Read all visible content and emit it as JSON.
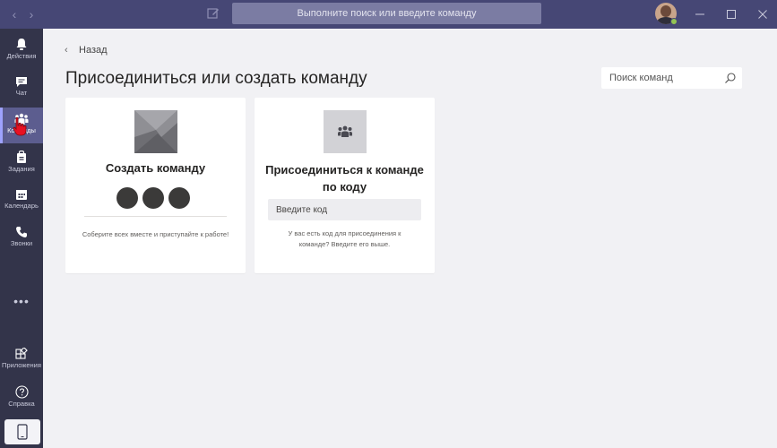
{
  "titlebar": {
    "search_placeholder": "Выполните поиск или введите команду"
  },
  "rail": {
    "items": [
      {
        "label": "Действия",
        "icon": "bell-icon"
      },
      {
        "label": "Чат",
        "icon": "chat-icon"
      },
      {
        "label": "Команды",
        "icon": "teams-icon",
        "active": true
      },
      {
        "label": "Задания",
        "icon": "assignments-icon"
      },
      {
        "label": "Календарь",
        "icon": "calendar-icon"
      },
      {
        "label": "Звонки",
        "icon": "phone-icon"
      },
      {
        "label": "Приложения",
        "icon": "apps-icon"
      },
      {
        "label": "Справка",
        "icon": "help-icon"
      }
    ],
    "more": "•••"
  },
  "main": {
    "back_label": "Назад",
    "title": "Присоединиться или создать команду",
    "search_placeholder": "Поиск команд",
    "create_card": {
      "title": "Создать команду",
      "description": "Соберите всех вместе и приступайте к работе!"
    },
    "join_card": {
      "title": "Присоединиться к команде по коду",
      "code_placeholder": "Введите код",
      "description": "У вас есть код для присоединения к команде? Введите его выше."
    }
  },
  "colors": {
    "titlebar": "#464775",
    "rail": "#33344a",
    "active_rail": "#5c5d8f",
    "page_bg": "#f1f1f4"
  }
}
